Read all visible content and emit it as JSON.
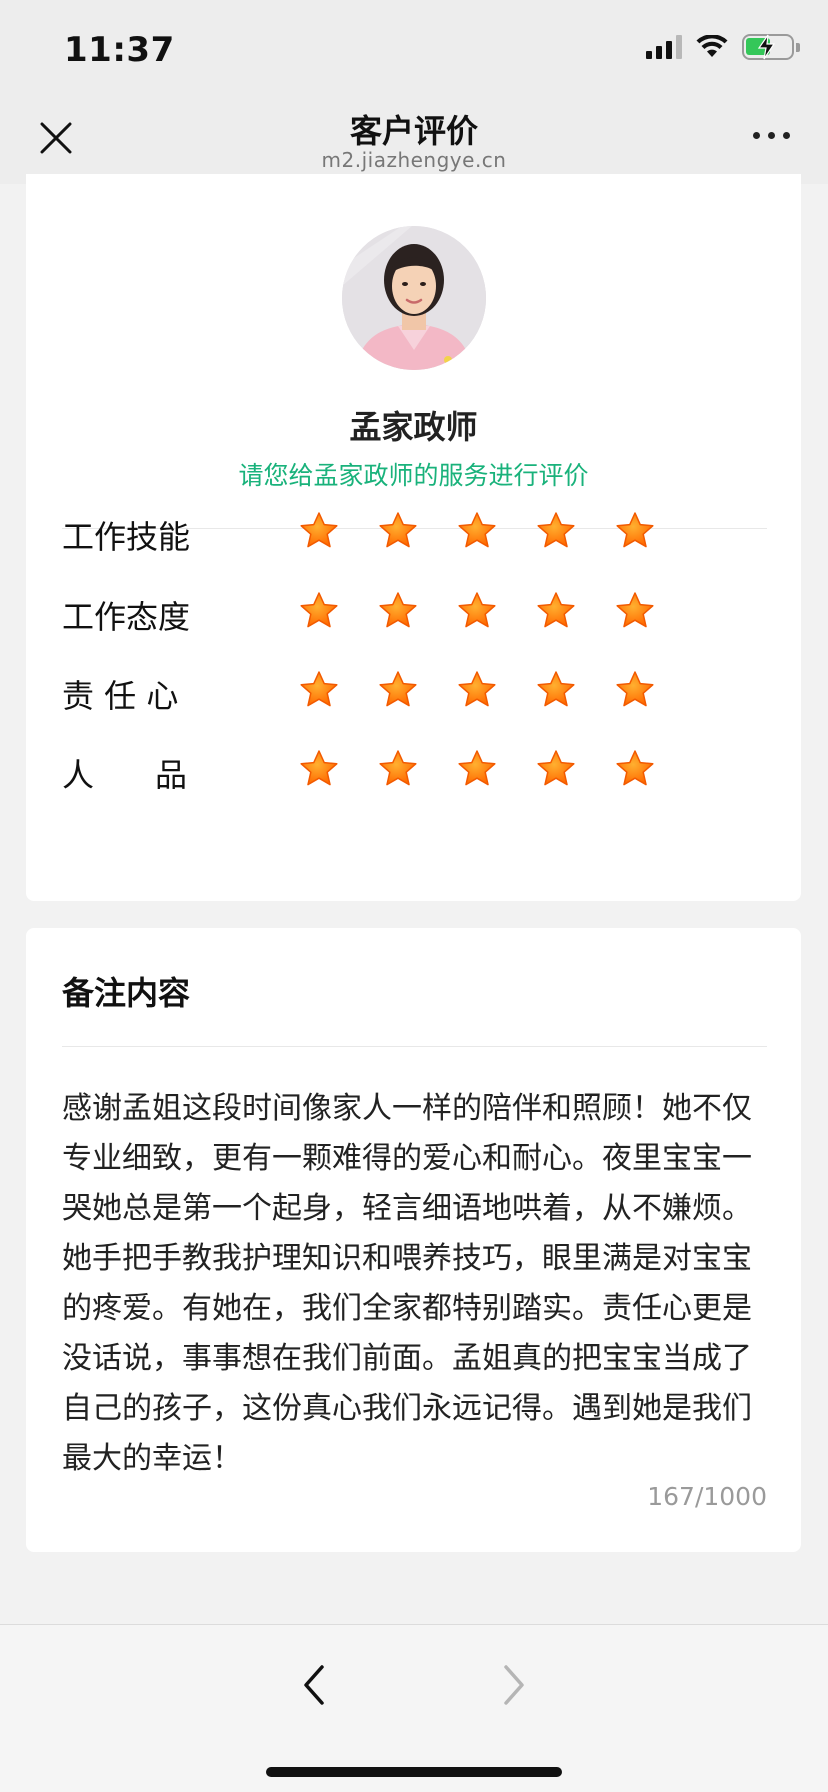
{
  "status_bar": {
    "time": "11:37",
    "battery_charging": true
  },
  "nav": {
    "title": "客户评价",
    "url": "m2.jiazhengye.cn"
  },
  "profile": {
    "name": "孟家政师",
    "prompt": "请您给孟家政师的服务进行评价"
  },
  "ratings": [
    {
      "label": "工作技能",
      "stars": 5,
      "max": 5
    },
    {
      "label": "工作态度",
      "stars": 5,
      "max": 5
    },
    {
      "label": "责 任 心",
      "stars": 5,
      "max": 5
    },
    {
      "label": "人      品",
      "stars": 5,
      "max": 5
    }
  ],
  "notes": {
    "title": "备注内容",
    "text": "感谢孟姐这段时间像家人一样的陪伴和照顾！她不仅专业细致，更有一颗难得的爱心和耐心。夜里宝宝一哭她总是第一个起身，轻言细语地哄着，从不嫌烦。她手把手教我护理知识和喂养技巧，眼里满是对宝宝的疼爱。有她在，我们全家都特别踏实。责任心更是没话说，事事想在我们前面。孟姐真的把宝宝当成了自己的孩子，这份真心我们永远记得。遇到她是我们最大的幸运！",
    "count": "167/1000"
  },
  "colors": {
    "accent": "#19b27b",
    "star": "#ff6a00"
  }
}
